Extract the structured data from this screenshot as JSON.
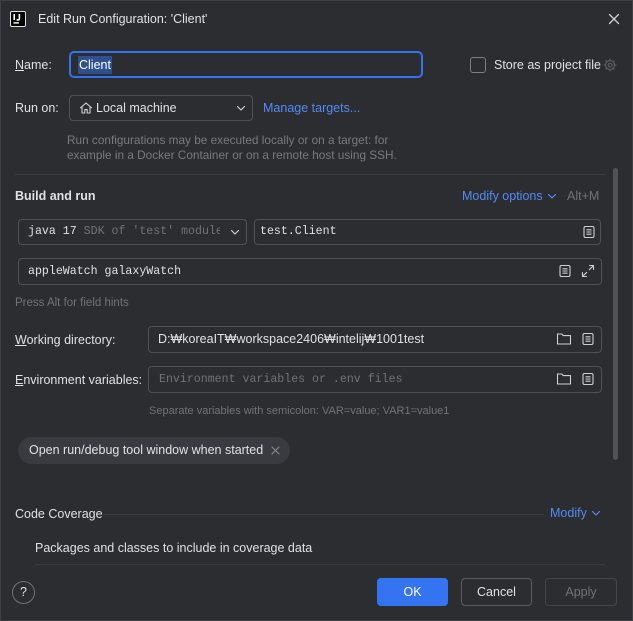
{
  "colors": {
    "background": "#2B2D30",
    "text": "#DFE1E5",
    "muted": "#6F737A",
    "accent": "#3574F0",
    "link": "#548AF7",
    "border": "#4E5157"
  },
  "window": {
    "title": "Edit Run Configuration: 'Client'",
    "app_icon": "intellij-idea-icon",
    "close_icon": "close-icon"
  },
  "name": {
    "label": "Name:",
    "value": "Client",
    "value_selected": true
  },
  "store_as_project_file": {
    "label": "Store as project file",
    "checked": false,
    "icon": "gear-icon"
  },
  "run_on": {
    "label": "Run on:",
    "selected": "Local machine",
    "icon": "home-icon",
    "manage_targets": "Manage targets...",
    "description": [
      "Run configurations may be executed locally or on a target: for",
      "example in a Docker Container or on a remote host using SSH."
    ]
  },
  "build_and_run": {
    "title": "Build and run",
    "modify_options": "Modify options",
    "shortcut": "Alt+M",
    "jdk": {
      "name": "java 17",
      "detail": "SDK of 'test' module"
    },
    "main_class": "test.Client",
    "program_arguments": "appleWatch galaxyWatch",
    "field_hint": "Press Alt for field hints"
  },
  "working_directory": {
    "label": "Working directory:",
    "value": "D:₩koreaIT₩workspace2406₩intelij₩1001test"
  },
  "environment_variables": {
    "label": "Environment variables:",
    "placeholder": "Environment variables or .env files",
    "hint": "Separate variables with semicolon: VAR=value; VAR1=value1"
  },
  "options": [
    {
      "label": "Open run/debug tool window when started",
      "removable": true
    }
  ],
  "code_coverage": {
    "title": "Code Coverage",
    "modify": "Modify",
    "packages_label": "Packages and classes to include in coverage data"
  },
  "footer": {
    "help": "?",
    "ok": "OK",
    "cancel": "Cancel",
    "apply": "Apply",
    "apply_enabled": false
  }
}
